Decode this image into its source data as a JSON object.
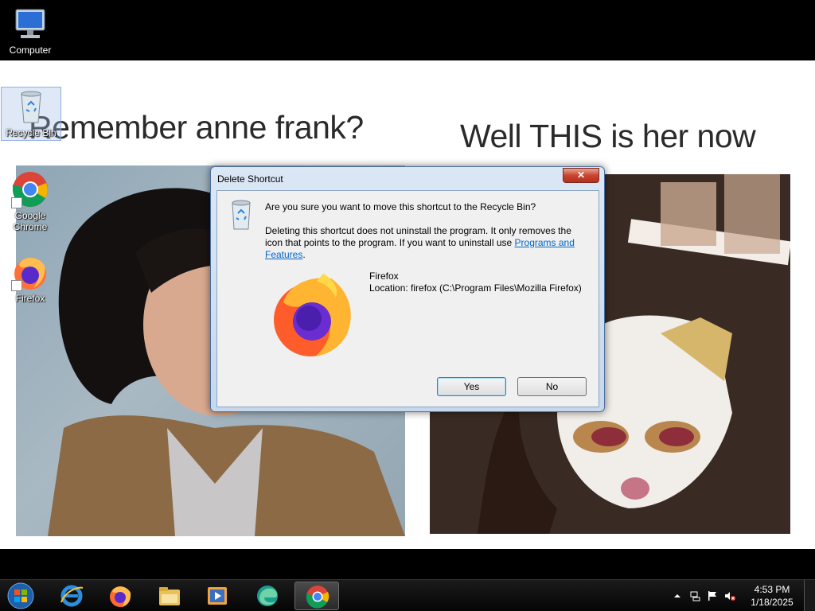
{
  "desktop": {
    "icons": [
      {
        "label": "Computer",
        "icon": "computer-icon"
      },
      {
        "label": "Recycle Bin",
        "icon": "recycle-bin-icon"
      },
      {
        "label": "Google Chrome",
        "icon": "chrome-icon"
      },
      {
        "label": "Firefox",
        "icon": "firefox-icon"
      }
    ],
    "wallpaper": {
      "caption_left": "Remember anne frank?",
      "caption_right": "Well THIS is her now"
    }
  },
  "dialog": {
    "title": "Delete Shortcut",
    "close_glyph": "✕",
    "question": "Are you sure you want to move this shortcut to the Recycle Bin?",
    "details": "Deleting this shortcut does not uninstall the program. It only removes the icon that points to the program. If you want to uninstall use ",
    "link_text": "Programs and Features",
    "details_end": ".",
    "file_name": "Firefox",
    "file_location": "Location: firefox (C:\\Program Files\\Mozilla Firefox)",
    "buttons": {
      "yes": "Yes",
      "no": "No"
    }
  },
  "taskbar": {
    "items": [
      "start-orb-icon",
      "internet-explorer-icon",
      "firefox-icon",
      "file-explorer-icon",
      "media-player-icon",
      "edge-icon",
      "chrome-icon"
    ],
    "active_item": "chrome-icon",
    "clock": {
      "time": "4:53 PM",
      "date": "1/18/2025"
    }
  },
  "colors": {
    "taskbar": "#0a0a0a",
    "dialog_frame": "#c6d8ee",
    "close_button": "#c9452f",
    "link": "#0066cc"
  }
}
